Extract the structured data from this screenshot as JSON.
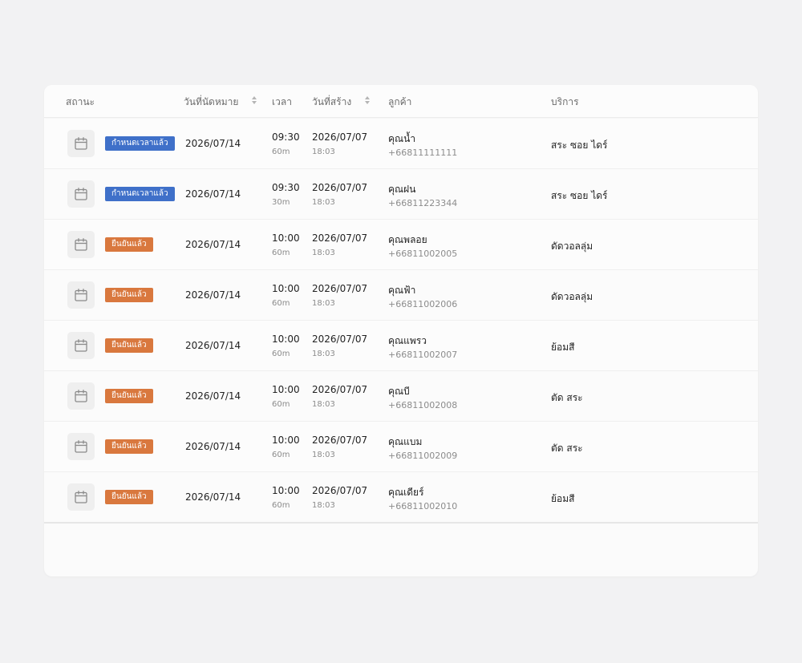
{
  "table": {
    "headers": {
      "status": "สถานะ",
      "appointment_date": "วันที่นัดหมาย",
      "time": "เวลา",
      "created_date": "วันที่สร้าง",
      "customer": "ลูกค้า",
      "service": "บริการ"
    },
    "rows": [
      {
        "status": "กำหนดเวลาแล้ว",
        "status_type": "scheduled",
        "date": "2026/07/14",
        "time": "09:30",
        "duration": "60m",
        "created_date": "2026/07/07",
        "created_time": "18:03",
        "customer_name": "คุณน้ำ",
        "phone": "+66811111111",
        "service": "สระ ซอย ไดร์"
      },
      {
        "status": "กำหนดเวลาแล้ว",
        "status_type": "scheduled",
        "date": "2026/07/14",
        "time": "09:30",
        "duration": "30m",
        "created_date": "2026/07/07",
        "created_time": "18:03",
        "customer_name": "คุณฝน",
        "phone": "+66811223344",
        "service": "สระ ซอย ไดร์"
      },
      {
        "status": "ยืนยันแล้ว",
        "status_type": "confirmed",
        "date": "2026/07/14",
        "time": "10:00",
        "duration": "60m",
        "created_date": "2026/07/07",
        "created_time": "18:03",
        "customer_name": "คุณพลอย",
        "phone": "+66811002005",
        "service": "ดัดวอลลุ่ม"
      },
      {
        "status": "ยืนยันแล้ว",
        "status_type": "confirmed",
        "date": "2026/07/14",
        "time": "10:00",
        "duration": "60m",
        "created_date": "2026/07/07",
        "created_time": "18:03",
        "customer_name": "คุณฟ้า",
        "phone": "+66811002006",
        "service": "ดัดวอลลุ่ม"
      },
      {
        "status": "ยืนยันแล้ว",
        "status_type": "confirmed",
        "date": "2026/07/14",
        "time": "10:00",
        "duration": "60m",
        "created_date": "2026/07/07",
        "created_time": "18:03",
        "customer_name": "คุณแพรว",
        "phone": "+66811002007",
        "service": "ย้อมสี"
      },
      {
        "status": "ยืนยันแล้ว",
        "status_type": "confirmed",
        "date": "2026/07/14",
        "time": "10:00",
        "duration": "60m",
        "created_date": "2026/07/07",
        "created_time": "18:03",
        "customer_name": "คุณบี",
        "phone": "+66811002008",
        "service": "ตัด สระ"
      },
      {
        "status": "ยืนยันแล้ว",
        "status_type": "confirmed",
        "date": "2026/07/14",
        "time": "10:00",
        "duration": "60m",
        "created_date": "2026/07/07",
        "created_time": "18:03",
        "customer_name": "คุณแบม",
        "phone": "+66811002009",
        "service": "ตัด สระ"
      },
      {
        "status": "ยืนยันแล้ว",
        "status_type": "confirmed",
        "date": "2026/07/14",
        "time": "10:00",
        "duration": "60m",
        "created_date": "2026/07/07",
        "created_time": "18:03",
        "customer_name": "คุณเดียร์",
        "phone": "+66811002010",
        "service": "ย้อมสี"
      }
    ]
  },
  "colors": {
    "scheduled_badge": "#3f70c9",
    "confirmed_badge": "#d9783e",
    "background": "#f2f2f3",
    "card": "#fbfbfb"
  },
  "icons": {
    "row_action": "calendar-icon",
    "sort": "sort-icon"
  }
}
